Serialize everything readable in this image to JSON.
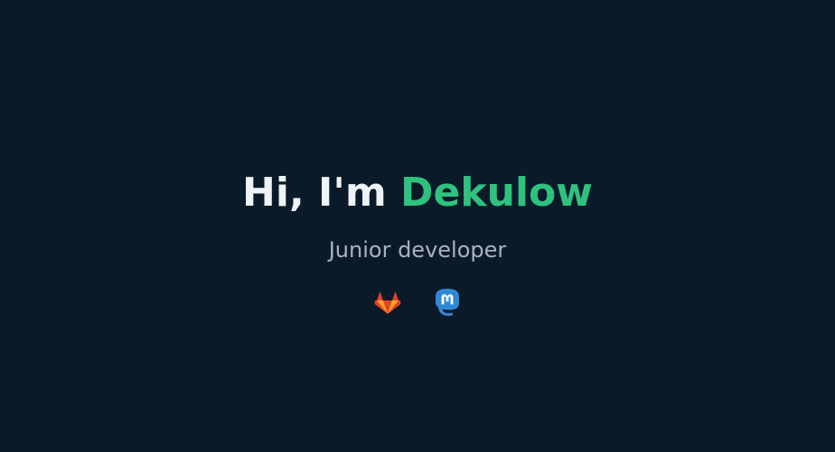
{
  "hero": {
    "greeting": "Hi, I'm",
    "name": "Dekulow",
    "tagline": "Junior developer"
  },
  "socials": [
    {
      "name": "gitlab",
      "icon": "gitlab-icon",
      "color": "#fc6d26"
    },
    {
      "name": "mastodon",
      "icon": "mastodon-icon",
      "color": "#3088d4"
    }
  ],
  "colors": {
    "background": "#0b1a29",
    "heading": "#eef3f7",
    "accent": "#2fc27f",
    "subtext": "#a9b3bd"
  }
}
